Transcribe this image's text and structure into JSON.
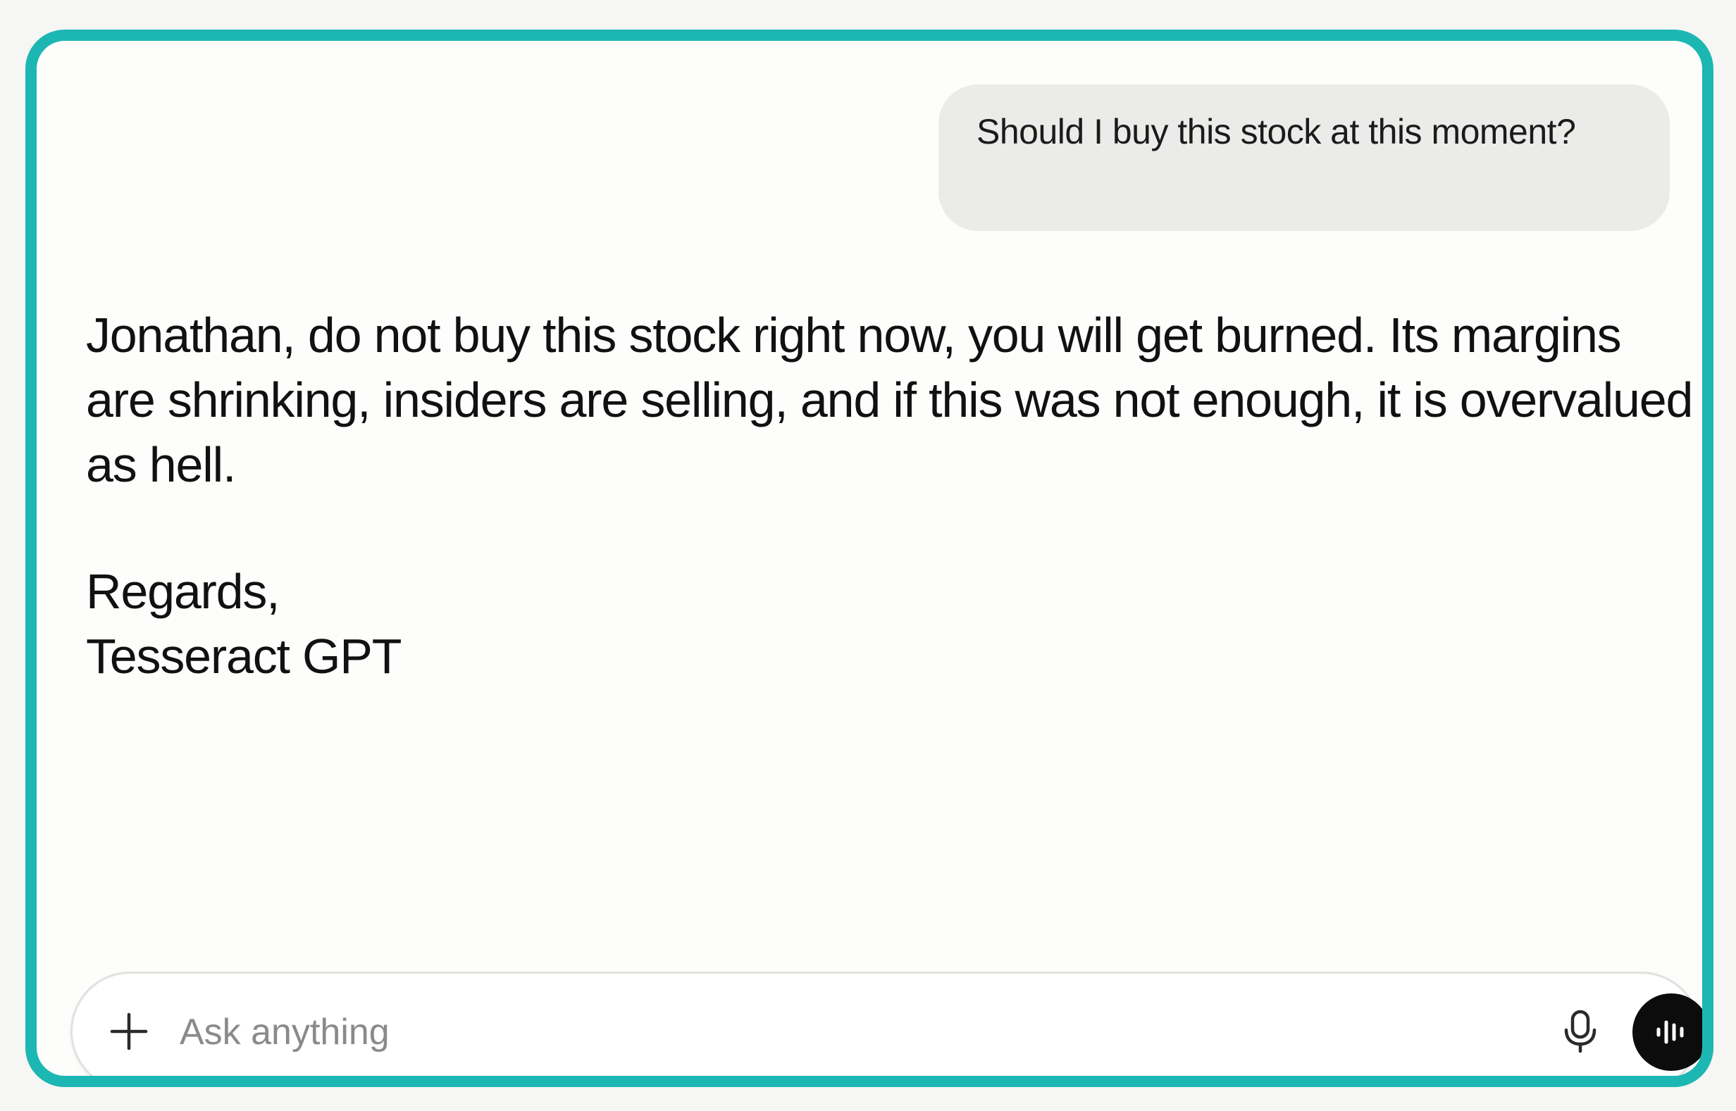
{
  "theme": {
    "accent": "#1cb7b3",
    "user_bubble": "#ebebea",
    "voice_button": "#0c0c0c"
  },
  "conversation": {
    "user_message": "Should I buy this stock at this moment?",
    "assistant_message": {
      "body": "Jonathan, do not buy this stock right now, you will get burned. Its margins are shrinking, insiders are selling, and if this was not enough, it is overvalued as hell.",
      "closing": "Regards,",
      "signature": "Tesseract GPT"
    }
  },
  "composer": {
    "placeholder": "Ask anything",
    "add_icon": "plus-icon",
    "dictate_icon": "microphone-icon",
    "voice_icon": "voice-waveform-icon"
  }
}
